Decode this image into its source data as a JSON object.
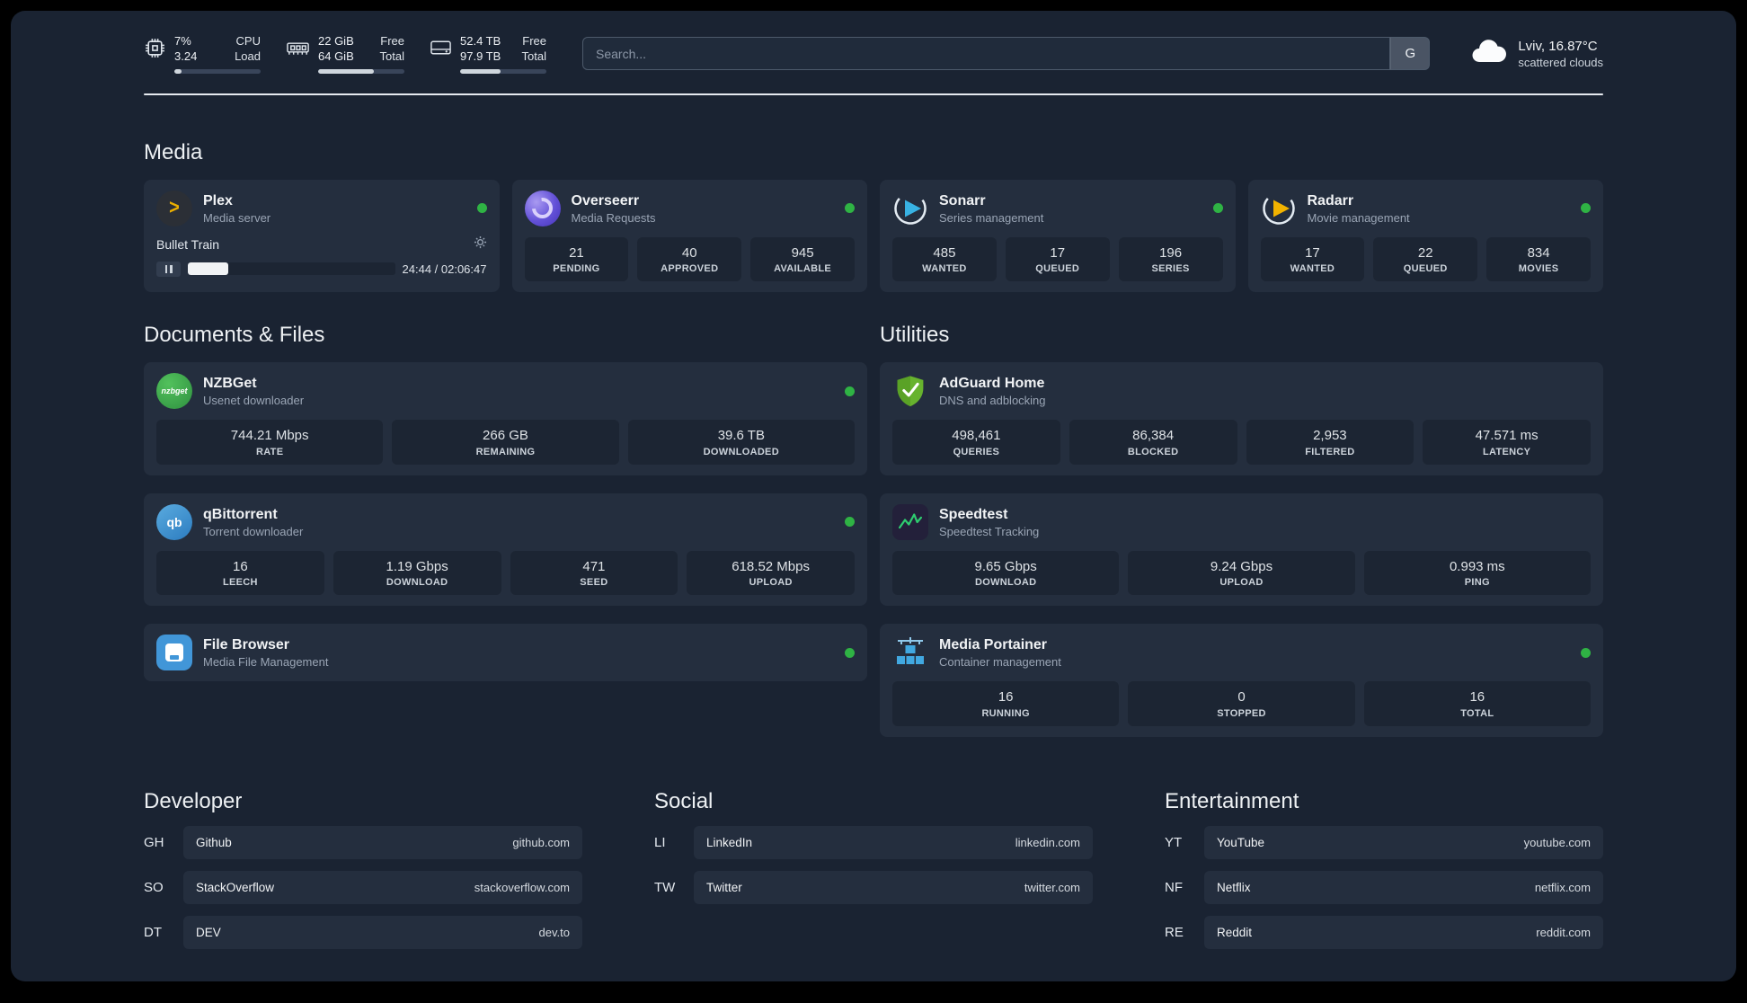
{
  "topbar": {
    "cpu": {
      "value1": "7%",
      "label1": "CPU",
      "value2": "3.24",
      "label2": "Load",
      "bar_percent": 8
    },
    "ram": {
      "value1": "22 GiB",
      "label1": "Free",
      "value2": "64 GiB",
      "label2": "Total",
      "bar_percent": 65
    },
    "disk": {
      "value1": "52.4 TB",
      "label1": "Free",
      "value2": "97.9 TB",
      "label2": "Total",
      "bar_percent": 47
    },
    "search": {
      "placeholder": "Search...",
      "button_label": "G"
    },
    "weather": {
      "location": "Lviv, 16.87°C",
      "condition": "scattered clouds"
    }
  },
  "sections": {
    "media": {
      "title": "Media"
    },
    "documents": {
      "title": "Documents & Files"
    },
    "utilities": {
      "title": "Utilities"
    },
    "developer": {
      "title": "Developer"
    },
    "social": {
      "title": "Social"
    },
    "entertainment": {
      "title": "Entertainment"
    }
  },
  "apps": {
    "plex": {
      "name": "Plex",
      "subtitle": "Media server",
      "icon_glyph": ">",
      "now_playing": "Bullet Train",
      "time": "24:44 / 02:06:47",
      "progress_percent": 19.5
    },
    "overseerr": {
      "name": "Overseerr",
      "subtitle": "Media Requests",
      "stats": [
        {
          "value": "21",
          "label": "PENDING"
        },
        {
          "value": "40",
          "label": "APPROVED"
        },
        {
          "value": "945",
          "label": "AVAILABLE"
        }
      ]
    },
    "sonarr": {
      "name": "Sonarr",
      "subtitle": "Series management",
      "stats": [
        {
          "value": "485",
          "label": "WANTED"
        },
        {
          "value": "17",
          "label": "QUEUED"
        },
        {
          "value": "196",
          "label": "SERIES"
        }
      ]
    },
    "radarr": {
      "name": "Radarr",
      "subtitle": "Movie management",
      "stats": [
        {
          "value": "17",
          "label": "WANTED"
        },
        {
          "value": "22",
          "label": "QUEUED"
        },
        {
          "value": "834",
          "label": "MOVIES"
        }
      ]
    },
    "nzbget": {
      "name": "NZBGet",
      "subtitle": "Usenet downloader",
      "icon_text": "nzbget",
      "stats": [
        {
          "value": "744.21 Mbps",
          "label": "RATE"
        },
        {
          "value": "266 GB",
          "label": "REMAINING"
        },
        {
          "value": "39.6 TB",
          "label": "DOWNLOADED"
        }
      ]
    },
    "qbittorrent": {
      "name": "qBittorrent",
      "subtitle": "Torrent downloader",
      "icon_text": "qb",
      "stats": [
        {
          "value": "16",
          "label": "LEECH"
        },
        {
          "value": "1.19 Gbps",
          "label": "DOWNLOAD"
        },
        {
          "value": "471",
          "label": "SEED"
        },
        {
          "value": "618.52 Mbps",
          "label": "UPLOAD"
        }
      ]
    },
    "filebrowser": {
      "name": "File Browser",
      "subtitle": "Media File Management"
    },
    "adguard": {
      "name": "AdGuard Home",
      "subtitle": "DNS and adblocking",
      "stats": [
        {
          "value": "498,461",
          "label": "QUERIES"
        },
        {
          "value": "86,384",
          "label": "BLOCKED"
        },
        {
          "value": "2,953",
          "label": "FILTERED"
        },
        {
          "value": "47.571 ms",
          "label": "LATENCY"
        }
      ]
    },
    "speedtest": {
      "name": "Speedtest",
      "subtitle": "Speedtest Tracking",
      "stats": [
        {
          "value": "9.65 Gbps",
          "label": "DOWNLOAD"
        },
        {
          "value": "9.24 Gbps",
          "label": "UPLOAD"
        },
        {
          "value": "0.993 ms",
          "label": "PING"
        }
      ]
    },
    "portainer": {
      "name": "Media Portainer",
      "subtitle": "Container management",
      "stats": [
        {
          "value": "16",
          "label": "RUNNING"
        },
        {
          "value": "0",
          "label": "STOPPED"
        },
        {
          "value": "16",
          "label": "TOTAL"
        }
      ]
    }
  },
  "bookmarks": {
    "developer": [
      {
        "abbr": "GH",
        "name": "Github",
        "url": "github.com"
      },
      {
        "abbr": "SO",
        "name": "StackOverflow",
        "url": "stackoverflow.com"
      },
      {
        "abbr": "DT",
        "name": "DEV",
        "url": "dev.to"
      }
    ],
    "social": [
      {
        "abbr": "LI",
        "name": "LinkedIn",
        "url": "linkedin.com"
      },
      {
        "abbr": "TW",
        "name": "Twitter",
        "url": "twitter.com"
      }
    ],
    "entertainment": [
      {
        "abbr": "YT",
        "name": "YouTube",
        "url": "youtube.com"
      },
      {
        "abbr": "NF",
        "name": "Netflix",
        "url": "netflix.com"
      },
      {
        "abbr": "RE",
        "name": "Reddit",
        "url": "reddit.com"
      }
    ]
  }
}
